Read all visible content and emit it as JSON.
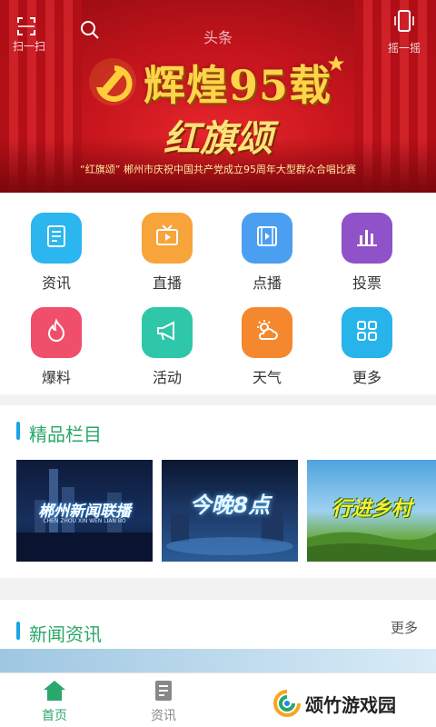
{
  "topbar": {
    "left_label": "扫一扫",
    "title": "头条",
    "right_label": "摇一摇"
  },
  "banner": {
    "headline": "辉煌95载",
    "subtitle": "红旗颂",
    "caption": "“红旗颂” 郴州市庆祝中国共产党成立95周年大型群众合唱比赛"
  },
  "grid": [
    {
      "label": "资讯",
      "icon": "news-icon",
      "color": "#2bb6ef"
    },
    {
      "label": "直播",
      "icon": "tv-icon",
      "color": "#f7a43b"
    },
    {
      "label": "点播",
      "icon": "video-icon",
      "color": "#4a9ff0"
    },
    {
      "label": "投票",
      "icon": "bar-chart-icon",
      "color": "#8f52c8"
    },
    {
      "label": "爆料",
      "icon": "flame-icon",
      "color": "#ef4f6b"
    },
    {
      "label": "活动",
      "icon": "megaphone-icon",
      "color": "#2fc7a9"
    },
    {
      "label": "天气",
      "icon": "weather-icon",
      "color": "#f5872e"
    },
    {
      "label": "更多",
      "icon": "grid-icon",
      "color": "#27b4ea"
    }
  ],
  "featured": {
    "title": "精品栏目",
    "items": [
      {
        "title": "郴州新闻联播",
        "sub": "CHEN ZHOU XIN WEN LIAN BO"
      },
      {
        "title": "今晚8点"
      },
      {
        "title": "行进乡村"
      }
    ]
  },
  "news": {
    "title": "新闻资讯",
    "more": "更多"
  },
  "tabs": [
    {
      "label": "首页",
      "active": true
    },
    {
      "label": "资讯",
      "active": false
    }
  ],
  "watermark": {
    "text": "颂竹游戏园"
  },
  "colors": {
    "accent": "#2aa76a",
    "section_bar": "#1aa4e8",
    "tab_active": "#2aa76a",
    "tab_inactive": "#888888"
  }
}
